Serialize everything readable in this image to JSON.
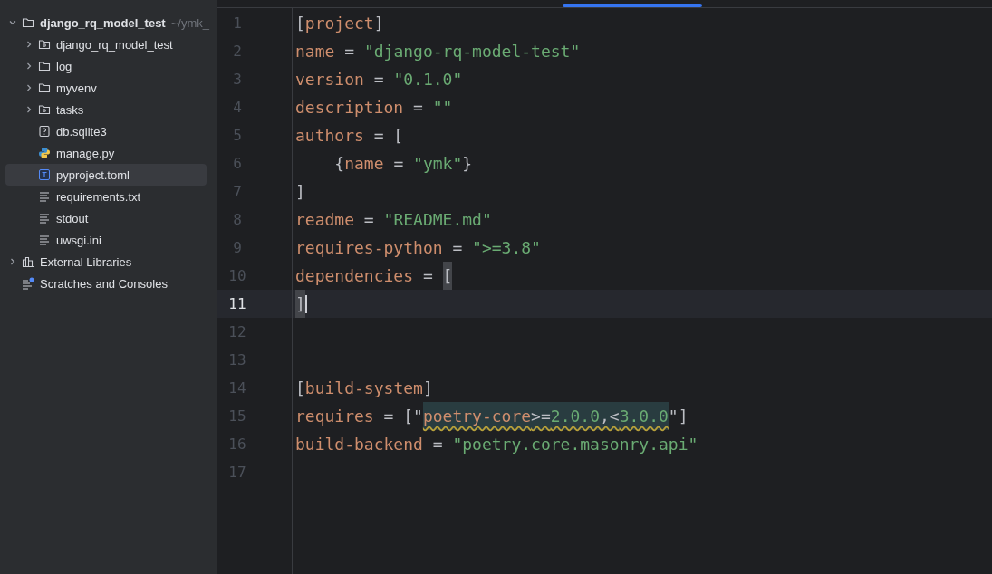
{
  "project_tree": [
    {
      "label": "django_rq_model_test",
      "path": "~/ymk_",
      "kind": "folder",
      "expanded": true,
      "selected": false,
      "children": [
        {
          "label": "django_rq_model_test",
          "kind": "package",
          "expanded": false,
          "selected": false
        },
        {
          "label": "log",
          "kind": "folder",
          "expanded": false,
          "selected": false
        },
        {
          "label": "myvenv",
          "kind": "folder",
          "expanded": false,
          "selected": false
        },
        {
          "label": "tasks",
          "kind": "package",
          "expanded": false,
          "selected": false
        },
        {
          "label": "db.sqlite3",
          "kind": "unknown",
          "selected": false
        },
        {
          "label": "manage.py",
          "kind": "python",
          "selected": false
        },
        {
          "label": "pyproject.toml",
          "kind": "toml",
          "selected": true
        },
        {
          "label": "requirements.txt",
          "kind": "text",
          "selected": false
        },
        {
          "label": "stdout",
          "kind": "text",
          "selected": false
        },
        {
          "label": "uwsgi.ini",
          "kind": "text",
          "selected": false
        }
      ]
    },
    {
      "label": "External Libraries",
      "kind": "libraries",
      "expanded": false,
      "selected": false
    },
    {
      "label": "Scratches and Consoles",
      "kind": "scratches",
      "selected": false
    }
  ],
  "editor": {
    "lines": [
      {
        "number": "1",
        "current": false,
        "tokens": [
          {
            "kind": "punct",
            "text": "["
          },
          {
            "kind": "key",
            "text": "project"
          },
          {
            "kind": "punct",
            "text": "]"
          }
        ]
      },
      {
        "number": "2",
        "current": false,
        "tokens": [
          {
            "kind": "key",
            "text": "name"
          },
          {
            "kind": "punct",
            "text": " = "
          },
          {
            "kind": "string",
            "text": "\"django-rq-model-test\""
          }
        ]
      },
      {
        "number": "3",
        "current": false,
        "tokens": [
          {
            "kind": "key",
            "text": "version"
          },
          {
            "kind": "punct",
            "text": " = "
          },
          {
            "kind": "string",
            "text": "\"0.1.0\""
          }
        ]
      },
      {
        "number": "4",
        "current": false,
        "tokens": [
          {
            "kind": "key",
            "text": "description"
          },
          {
            "kind": "punct",
            "text": " = "
          },
          {
            "kind": "string",
            "text": "\"\""
          }
        ]
      },
      {
        "number": "5",
        "current": false,
        "tokens": [
          {
            "kind": "key",
            "text": "authors"
          },
          {
            "kind": "punct",
            "text": " = ["
          }
        ]
      },
      {
        "number": "6",
        "current": false,
        "tokens": [
          {
            "kind": "punct",
            "text": "    {"
          },
          {
            "kind": "key",
            "text": "name"
          },
          {
            "kind": "punct",
            "text": " = "
          },
          {
            "kind": "string",
            "text": "\"ymk\""
          },
          {
            "kind": "punct",
            "text": "}"
          }
        ]
      },
      {
        "number": "7",
        "current": false,
        "tokens": [
          {
            "kind": "punct",
            "text": "]"
          }
        ]
      },
      {
        "number": "8",
        "current": false,
        "tokens": [
          {
            "kind": "key",
            "text": "readme"
          },
          {
            "kind": "punct",
            "text": " = "
          },
          {
            "kind": "string",
            "text": "\"README.md\""
          }
        ]
      },
      {
        "number": "9",
        "current": false,
        "tokens": [
          {
            "kind": "key",
            "text": "requires-python"
          },
          {
            "kind": "punct",
            "text": " = "
          },
          {
            "kind": "string",
            "text": "\">=3.8\""
          }
        ]
      },
      {
        "number": "10",
        "current": false,
        "tokens": [
          {
            "kind": "key",
            "text": "dependencies"
          },
          {
            "kind": "punct",
            "text": " = "
          },
          {
            "kind": "punct",
            "text": "[",
            "matched": true
          }
        ]
      },
      {
        "number": "11",
        "current": true,
        "caret": true,
        "tokens": [
          {
            "kind": "punct",
            "text": "]",
            "matched": true
          }
        ]
      },
      {
        "number": "12",
        "current": false
      },
      {
        "number": "13",
        "current": false
      },
      {
        "number": "14",
        "current": false,
        "tokens": [
          {
            "kind": "punct",
            "text": "["
          },
          {
            "kind": "key",
            "text": "build-system"
          },
          {
            "kind": "punct",
            "text": "]"
          }
        ]
      },
      {
        "number": "15",
        "current": false,
        "tokens": [
          {
            "kind": "key",
            "text": "requires"
          },
          {
            "kind": "punct",
            "text": " = [\""
          },
          {
            "kind": "key",
            "text": "poetry-core",
            "injected": true
          },
          {
            "kind": "punct",
            "text": ">=",
            "injected": true
          },
          {
            "kind": "string",
            "text": "2.0.0",
            "injected": true
          },
          {
            "kind": "punct",
            "text": ",<",
            "injected": true
          },
          {
            "kind": "string",
            "text": "3.0.0",
            "injected": true
          },
          {
            "kind": "punct",
            "text": "\"]"
          }
        ]
      },
      {
        "number": "16",
        "current": false,
        "tokens": [
          {
            "kind": "key",
            "text": "build-backend"
          },
          {
            "kind": "punct",
            "text": " = "
          },
          {
            "kind": "string",
            "text": "\"poetry.core.masonry.api\""
          }
        ]
      },
      {
        "number": "17",
        "current": false
      }
    ]
  }
}
